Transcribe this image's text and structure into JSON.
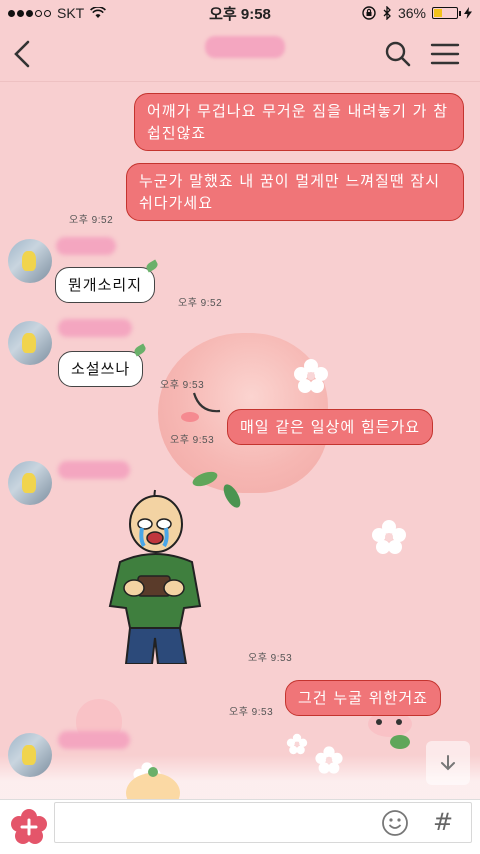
{
  "status_bar": {
    "carrier": "SKT",
    "time": "오후 9:58",
    "battery": "36%",
    "battery_level": 0.36
  },
  "header": {
    "title": ""
  },
  "messages": [
    {
      "side": "out",
      "text": "어깨가 무겁나요 무거운 짐을 내려놓기 가 참 쉽진않죠"
    },
    {
      "side": "out",
      "text": "누군가 말했죠 내 꿈이 멀게만 느껴질땐 잠시 쉬다가세요",
      "time": "오후 9:52"
    },
    {
      "side": "in",
      "text": "뭔개소리지",
      "time": "오후 9:52"
    },
    {
      "side": "in",
      "text": "소설쓰나",
      "time": "오후 9:53"
    },
    {
      "side": "out",
      "text": "매일 같은 일상에 힘든가요",
      "time": "오후 9:53"
    },
    {
      "side": "in",
      "type": "sticker",
      "time": "오후 9:53"
    },
    {
      "side": "out",
      "text": "그건 누굴 위한거죠",
      "time": "오후 9:53"
    }
  ],
  "input": {
    "value": "",
    "placeholder": "",
    "hash_label": "#"
  },
  "icons": {
    "back": "chevron-left-icon",
    "search": "search-icon",
    "menu": "hamburger-icon",
    "attach": "plus-flower-icon",
    "emoji": "smiley-icon",
    "scroll": "arrow-down-icon"
  },
  "colors": {
    "background": "#f8cfd0",
    "outgoing_bubble": "#f07578",
    "incoming_bubble": "#ffffff",
    "accent": "#e4556a"
  }
}
